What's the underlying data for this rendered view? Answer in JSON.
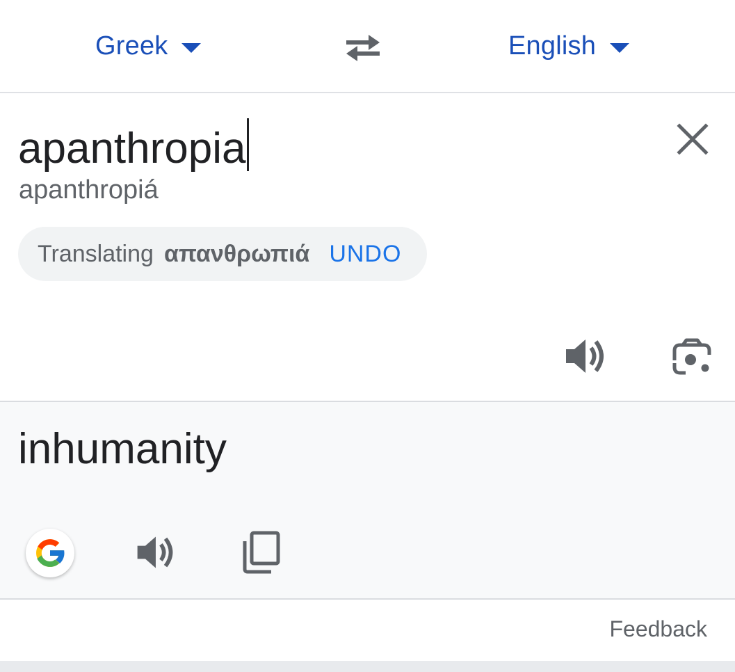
{
  "lang_bar": {
    "source_lang": "Greek",
    "target_lang": "English",
    "icons": {
      "caret": "dropdown-caret-icon",
      "swap": "swap-languages-icon"
    },
    "color": "#1a4fb8"
  },
  "input": {
    "text": "apanthropia",
    "transliteration": "apanthropiá",
    "chip": {
      "label": "Translating",
      "word": "απανθρωπιά",
      "undo": "UNDO"
    },
    "icons": {
      "clear": "close-icon",
      "speak": "speaker-icon",
      "camera": "lens-camera-icon"
    }
  },
  "output": {
    "text": "inhumanity",
    "icons": {
      "google": "google-g-icon",
      "speak": "speaker-icon",
      "copy": "copy-icon"
    },
    "background": "#f8f9fa"
  },
  "footer": {
    "feedback": "Feedback"
  },
  "accent_color": "#1a73e8"
}
